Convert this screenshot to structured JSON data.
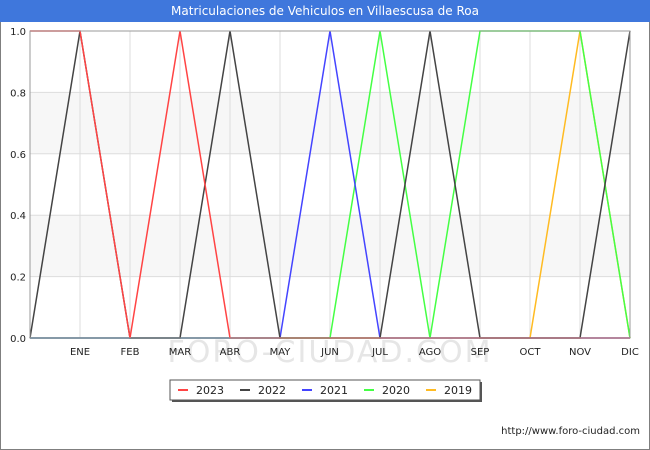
{
  "title": "Matriculaciones de Vehiculos en Villaescusa de Roa",
  "footer_url": "http://www.foro-ciudad.com",
  "watermark": "FORO-CIUDAD.COM",
  "chart_data": {
    "type": "line",
    "x_labels": [
      "",
      "ENE",
      "FEB",
      "MAR",
      "ABR",
      "MAY",
      "JUN",
      "JUL",
      "AGO",
      "SEP",
      "OCT",
      "NOV",
      "DIC"
    ],
    "ylim": [
      0,
      1.0
    ],
    "y_ticks": [
      "0.0",
      "0.2",
      "0.4",
      "0.6",
      "0.8",
      "1.0"
    ],
    "grid": true,
    "legend_position": "bottom",
    "series": [
      {
        "name": "2023",
        "color": "#ff4444",
        "values": [
          1,
          1,
          0,
          1,
          0,
          0,
          0,
          0,
          0,
          0,
          0,
          0,
          0
        ]
      },
      {
        "name": "2022",
        "color": "#444444",
        "values": [
          0,
          1,
          0,
          0,
          1,
          0,
          0,
          0,
          1,
          0,
          0,
          0,
          1
        ]
      },
      {
        "name": "2021",
        "color": "#4444ff",
        "values": [
          0,
          0,
          0,
          0,
          0,
          0,
          1,
          0,
          0,
          0,
          0,
          0,
          0
        ]
      },
      {
        "name": "2020",
        "color": "#44ff44",
        "values": [
          0,
          0,
          0,
          0,
          0,
          0,
          0,
          1,
          0,
          1,
          1,
          1,
          0
        ]
      },
      {
        "name": "2019",
        "color": "#ffbb22",
        "values": [
          0,
          0,
          0,
          0,
          0,
          0,
          0,
          0,
          0,
          0,
          0,
          1,
          0
        ]
      }
    ]
  }
}
